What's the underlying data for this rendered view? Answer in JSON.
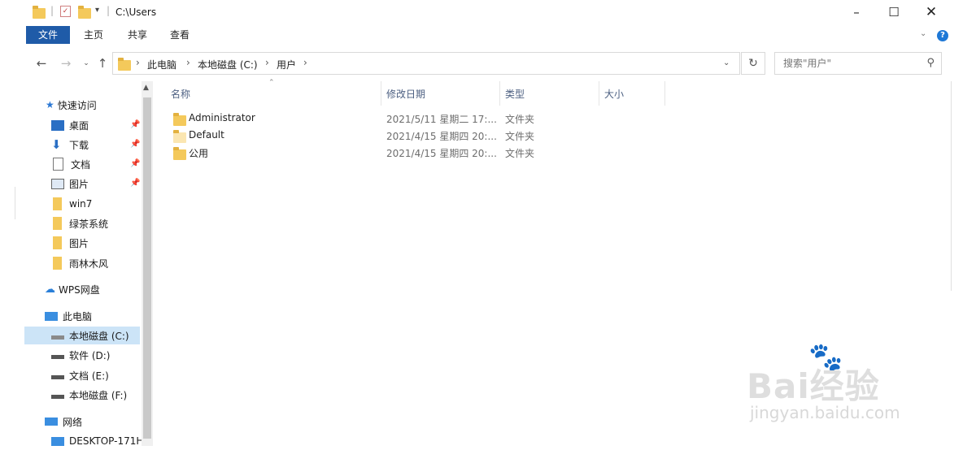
{
  "window": {
    "path_title": "C:\\Users"
  },
  "ribbon": {
    "tabs": [
      "文件",
      "主页",
      "共享",
      "查看"
    ]
  },
  "address": {
    "crumbs": [
      "此电脑",
      "本地磁盘 (C:)",
      "用户"
    ]
  },
  "search": {
    "placeholder": "搜索\"用户\""
  },
  "nav": {
    "quick_access": "快速访问",
    "pinned": [
      "桌面",
      "下载",
      "文档",
      "图片"
    ],
    "recent": [
      "win7",
      "绿茶系统",
      "图片",
      "雨林木风"
    ],
    "wps": "WPS网盘",
    "this_pc": "此电脑",
    "drives": [
      "本地磁盘 (C:)",
      "软件 (D:)",
      "文档 (E:)",
      "本地磁盘 (F:)"
    ],
    "network": "网络",
    "computer": "DESKTOP-171H"
  },
  "columns": [
    "名称",
    "修改日期",
    "类型",
    "大小"
  ],
  "files": [
    {
      "name": "Administrator",
      "date": "2021/5/11 星期二 17:...",
      "type": "文件夹"
    },
    {
      "name": "Default",
      "date": "2021/4/15 星期四 20:...",
      "type": "文件夹"
    },
    {
      "name": "公用",
      "date": "2021/4/15 星期四 20:...",
      "type": "文件夹"
    }
  ],
  "watermark": {
    "brand": "Bai经验",
    "url": "jingyan.baidu.com"
  },
  "colors": {
    "accent": "#1f5ba8",
    "selected": "#cce4f7",
    "folder": "#f4c95b"
  }
}
